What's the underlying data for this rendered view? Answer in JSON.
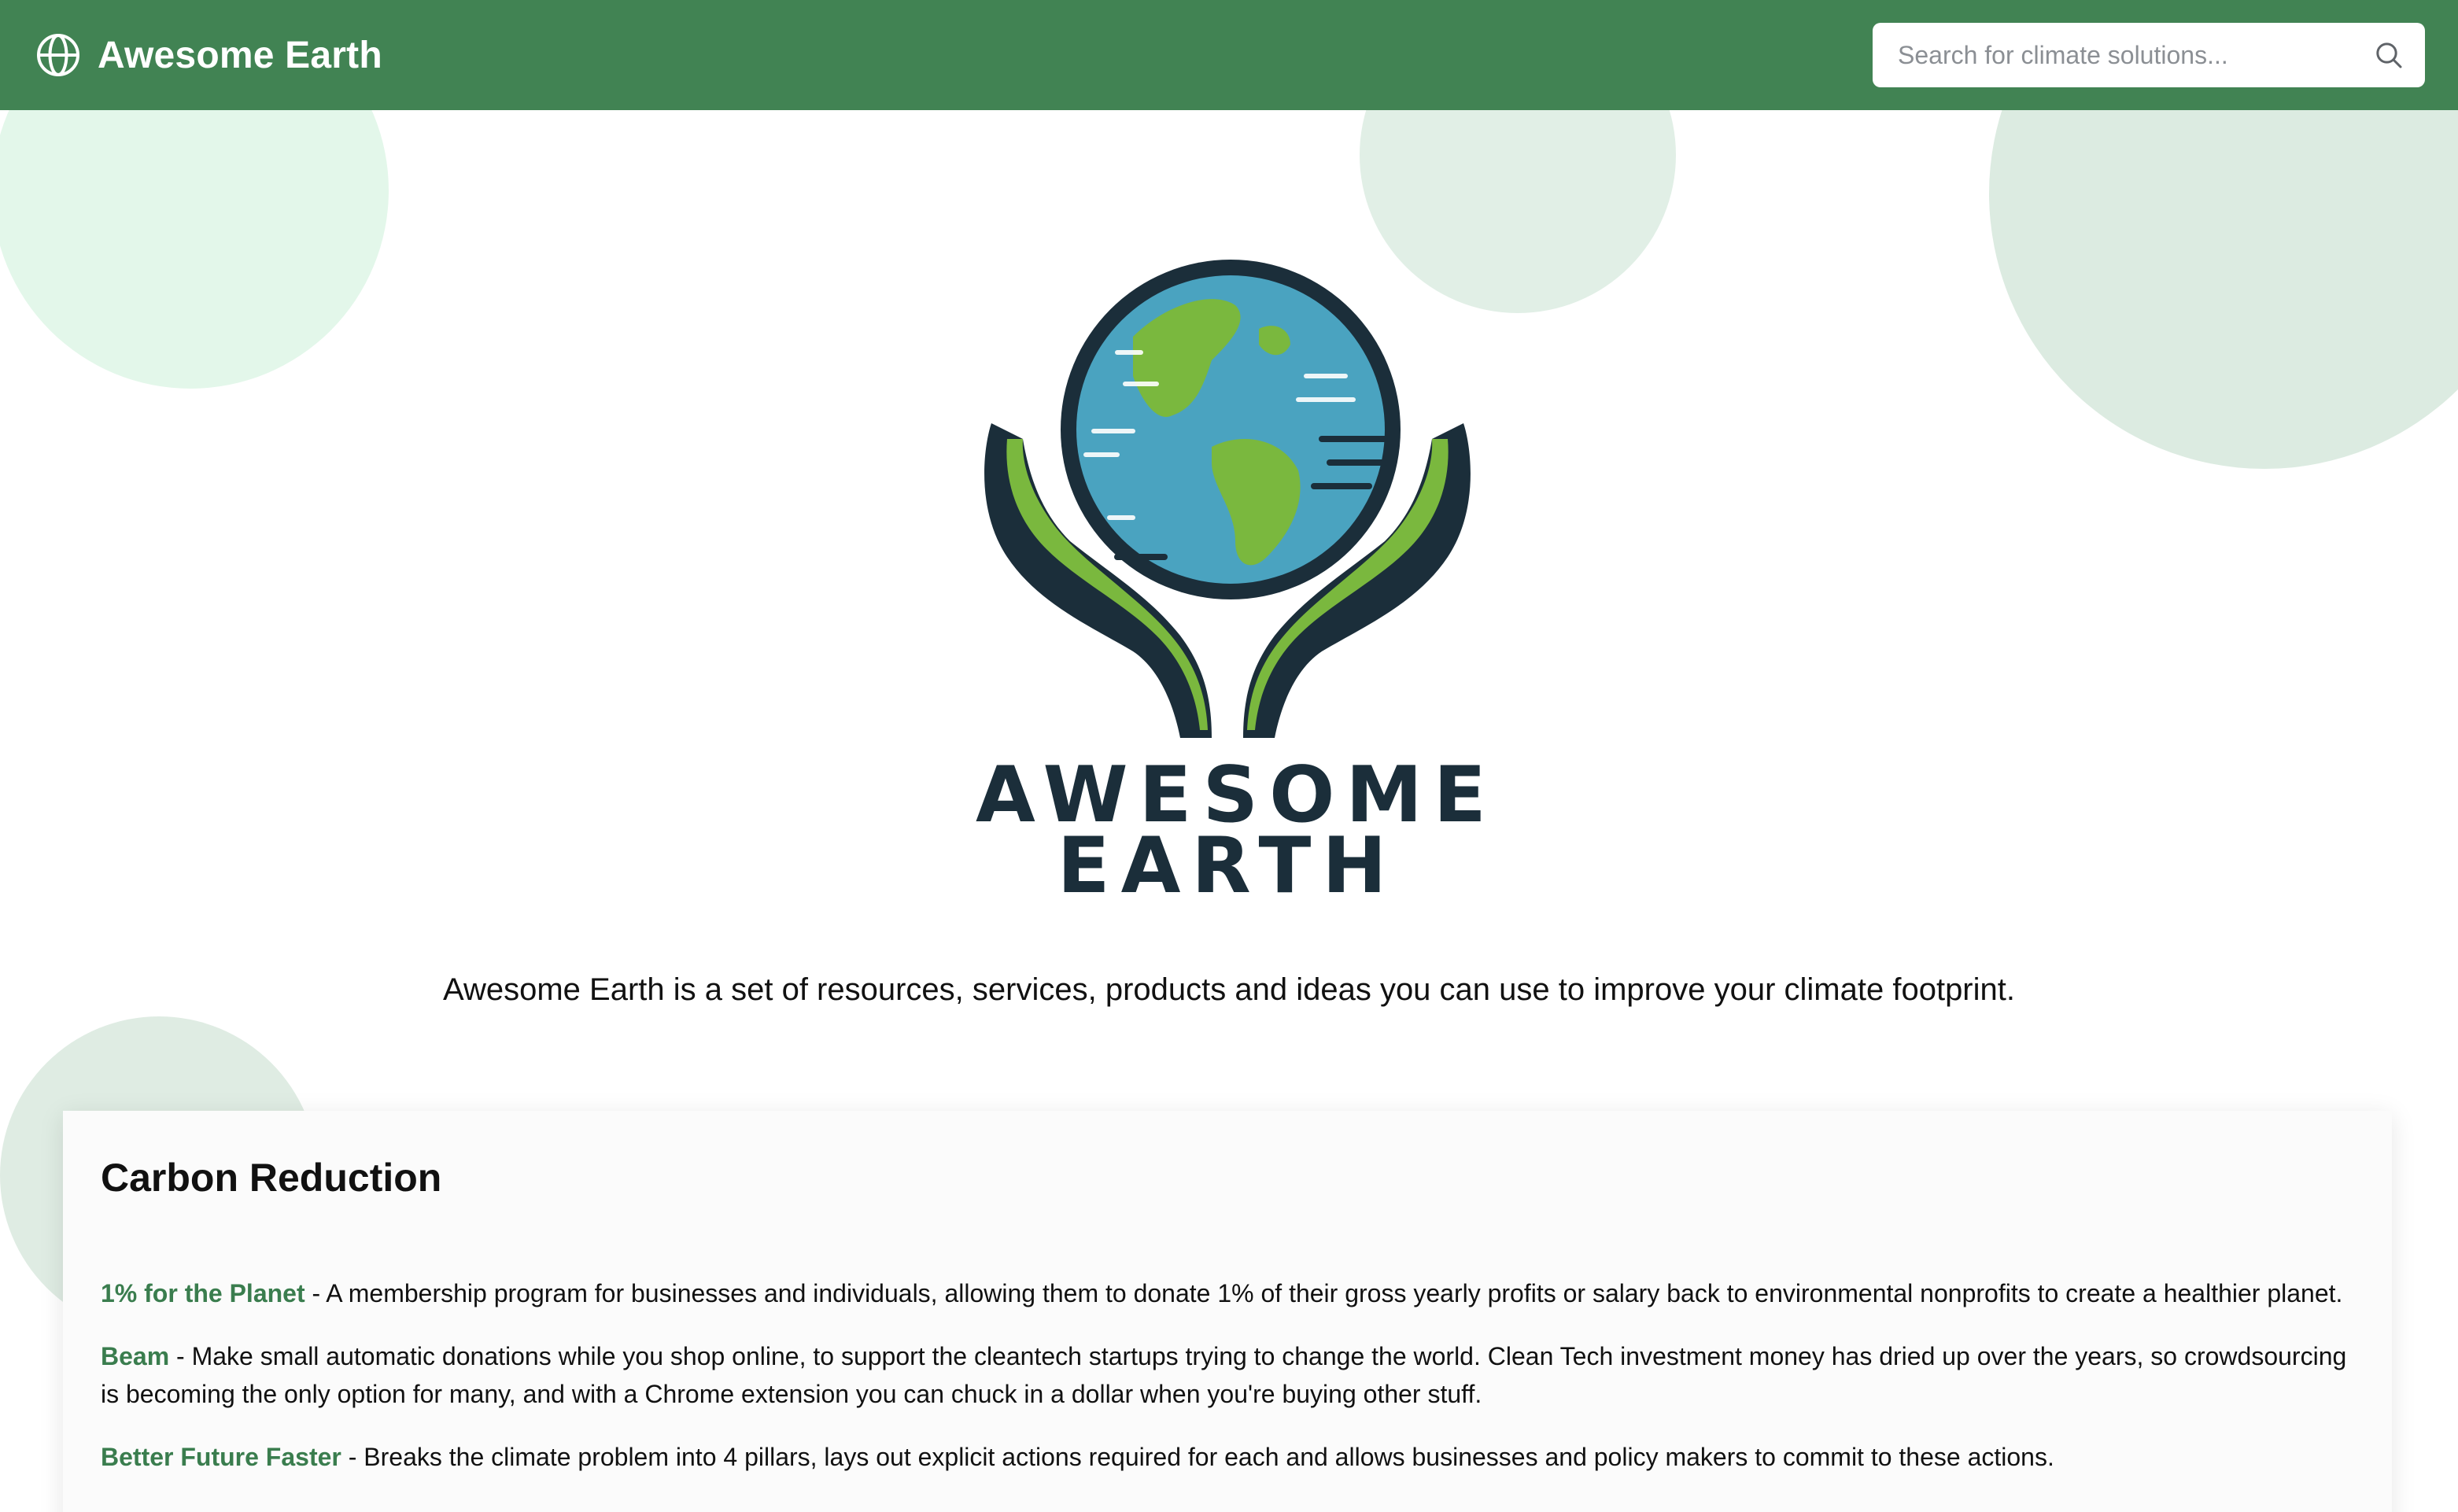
{
  "header": {
    "app_title": "Awesome Earth",
    "search_placeholder": "Search for climate solutions..."
  },
  "hero": {
    "logo_line1": "AWESOME",
    "logo_line2": "EARTH",
    "tagline": "Awesome Earth is a set of resources, services, products and ideas you can use to improve your climate footprint."
  },
  "section": {
    "title": "Carbon Reduction",
    "separator": " - ",
    "entries": [
      {
        "name": "1% for the Planet",
        "description": "A membership program for businesses and individuals, allowing them to donate 1% of their gross yearly profits or salary back to environmental nonprofits to create a healthier planet."
      },
      {
        "name": "Beam",
        "description": "Make small automatic donations while you shop online, to support the cleantech startups trying to change the world. Clean Tech investment money has dried up over the years, so crowdsourcing is becoming the only option for many, and with a Chrome extension you can chuck in a dollar when you're buying other stuff."
      },
      {
        "name": "Better Future Faster",
        "description": "Breaks the climate problem into 4 pillars, lays out explicit actions required for each and allows businesses and policy makers to commit to these actions."
      }
    ]
  },
  "colors": {
    "header_bg": "#418353",
    "link_green": "#3a7d4e",
    "logo_dark": "#1b2e3a",
    "ocean_blue": "#4aa3c0",
    "land_green": "#7ab83e"
  },
  "icons": {
    "brand": "globe-icon",
    "search": "search-icon"
  }
}
